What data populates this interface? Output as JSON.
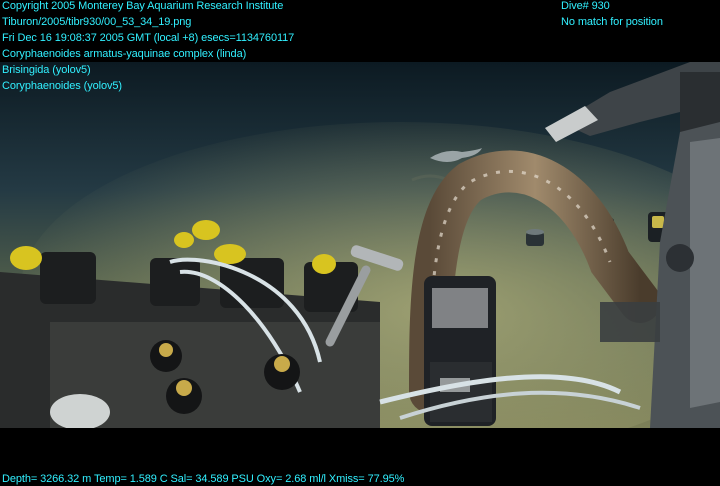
{
  "overlay": {
    "top_left": [
      "Copyright 2005 Monterey Bay Aquarium Research Institute",
      "Tiburon/2005/tibr930/00_53_34_19.png",
      "Fri Dec 16 19:08:37 2005 GMT (local +8)  esecs=1134760117",
      "Coryphaenoides armatus-yaquinae complex (linda)",
      "Brisingida (yolov5)",
      "Coryphaenoides (yolov5)"
    ],
    "top_right": [
      "Dive# 930",
      "No match for position"
    ],
    "bottom": "Depth= 3266.32 m  Temp= 1.589 C  Sal= 34.589 PSU  Oxy= 2.68 ml/l  Xmiss= 77.95%"
  },
  "colors": {
    "overlay_text": "#31f0ff",
    "seafloor": "#8a8c5c",
    "water": "#1d2d38"
  }
}
